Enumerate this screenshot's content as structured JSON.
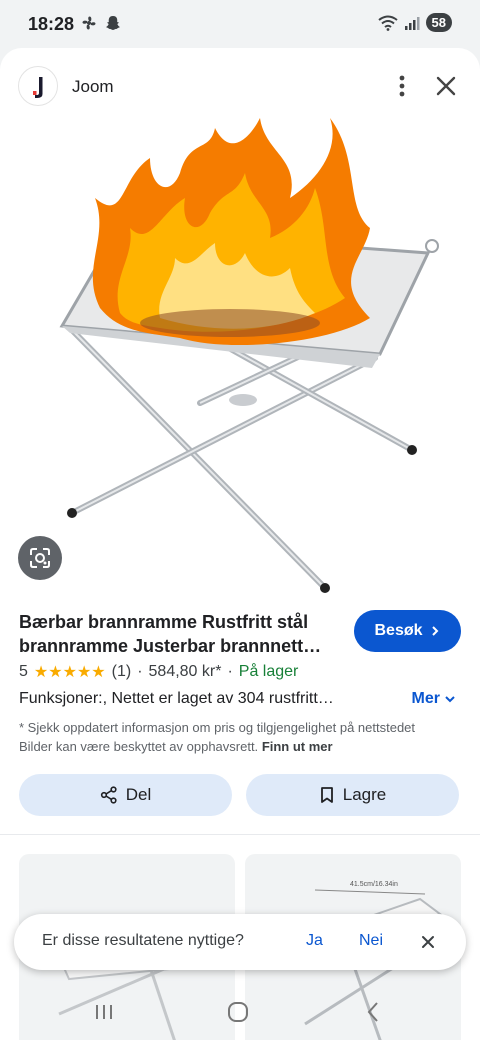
{
  "status_bar": {
    "time": "18:28",
    "battery": "58"
  },
  "header": {
    "site_name": "Joom"
  },
  "product": {
    "title": "Bærbar brannramme Rustfritt stål brannramme Justerbar brannnett…",
    "rating": "5",
    "stars": "★★★★★",
    "review_count": "(1)",
    "price": "584,80 kr*",
    "availability": "På lager",
    "features": "Funksjoner:, Nettet er laget av 304 rustfritt…",
    "more_label": "Mer",
    "disclaimer": "* Sjekk oppdatert informasjon om pris og tilgjengelighet på nettstedet Bilder kan være beskyttet av opphavsrett.",
    "learn_more": "Finn ut mer"
  },
  "actions": {
    "visit_label": "Besøk",
    "share_label": "Del",
    "save_label": "Lagre"
  },
  "feedback": {
    "question": "Er disse resultatene nyttige?",
    "yes": "Ja",
    "no": "Nei"
  },
  "thumbnail_label": "41.5cm/16.34in",
  "colors": {
    "accent": "#0b57d0",
    "star": "#f9ab00",
    "in_stock": "#188038",
    "chip_bg": "#dfeaf9"
  }
}
